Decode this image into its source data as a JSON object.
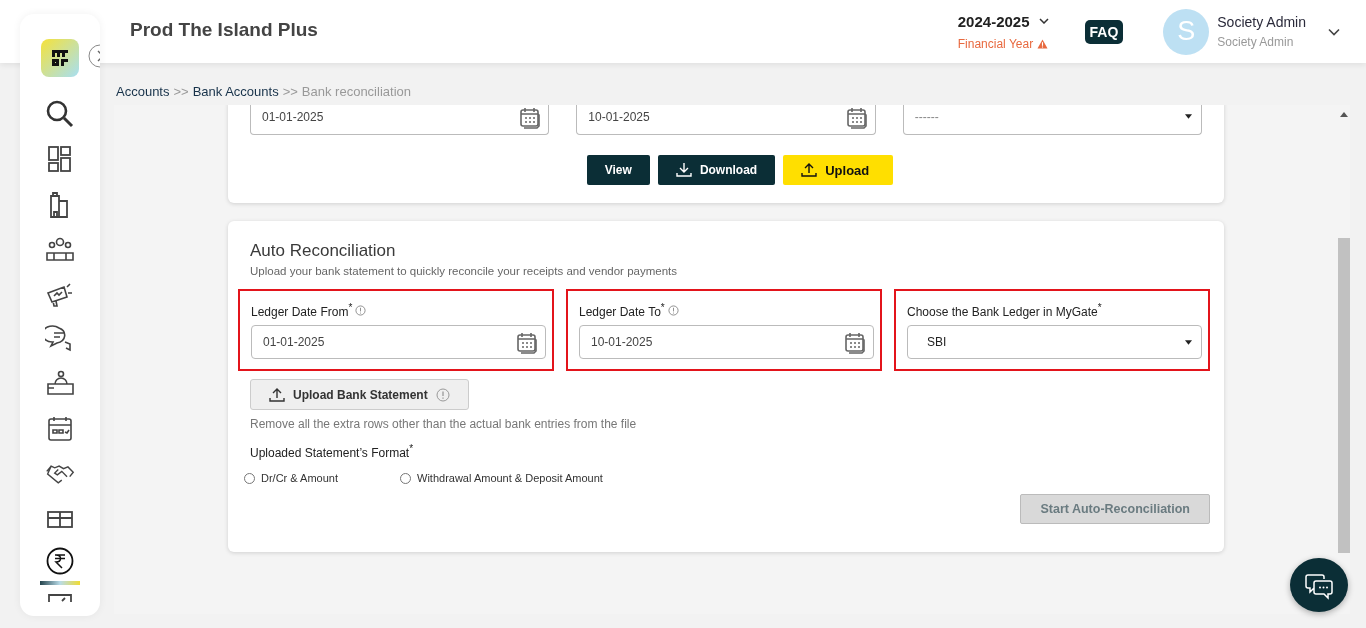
{
  "header": {
    "title": "Prod The Island Plus",
    "year": "2024-2025",
    "year_caption": "Financial Year",
    "faq": "FAQ",
    "avatar_letter": "S",
    "user_name": "Society Admin",
    "user_role": "Society Admin"
  },
  "sidebar": {
    "items": [
      {
        "kind": "search",
        "selected": false
      },
      {
        "kind": "dashboard",
        "selected": false
      },
      {
        "kind": "building",
        "selected": false
      },
      {
        "kind": "people",
        "selected": false
      },
      {
        "kind": "megaphone",
        "selected": false
      },
      {
        "kind": "chat",
        "selected": false
      },
      {
        "kind": "desk",
        "selected": false
      },
      {
        "kind": "calendar",
        "selected": false
      },
      {
        "kind": "handshake",
        "selected": false
      },
      {
        "kind": "box",
        "selected": false
      },
      {
        "kind": "rupee",
        "selected": true
      },
      {
        "kind": "cut",
        "selected": false
      }
    ]
  },
  "breadcrumb": [
    {
      "label": "Accounts",
      "current": false
    },
    {
      "label": "Bank Accounts",
      "prefix": ">>",
      "current": false
    },
    {
      "label": "Bank reconciliation",
      "prefix": ">>",
      "current": true
    }
  ],
  "top_card": {
    "fields": [
      {
        "kind": "date",
        "value": "01-01-2025"
      },
      {
        "kind": "date",
        "value": "10-01-2025"
      },
      {
        "kind": "select",
        "placeholder": "------"
      }
    ],
    "buttons": [
      {
        "label": "View",
        "kind": "view"
      },
      {
        "label": "Download",
        "kind": "download"
      },
      {
        "label": "Upload",
        "kind": "upload"
      }
    ]
  },
  "auto": {
    "title": "Auto Reconciliation",
    "subtitle": "Upload your bank statement to quickly reconcile your receipts and vendor payments",
    "fields": [
      {
        "label": "Ledger Date From$^{*}$",
        "info": true,
        "kind": "date",
        "value": "01-01-2025",
        "highlighted": true
      },
      {
        "label": "Ledger Date To$^{*}$",
        "info": true,
        "kind": "date",
        "value": "10-01-2025",
        "highlighted": true
      },
      {
        "label": "Choose the Bank Ledger in MyGate$^{*}$",
        "info": false,
        "kind": "select",
        "value": "SBI",
        "highlighted": true
      }
    ],
    "upload_button": "Upload Bank Statement",
    "hint": "Remove all the extra rows other than the actual bank entries from the file",
    "format_label": "Uploaded Statement’s Format$^{*}$",
    "options": [
      {
        "label": "Dr/Cr & Amount",
        "selected": false
      },
      {
        "label": "Withdrawal Amount & Deposit Amount",
        "selected": false
      }
    ],
    "start_button": {
      "label": "Start Auto-Reconciliation",
      "disabled": true
    }
  }
}
